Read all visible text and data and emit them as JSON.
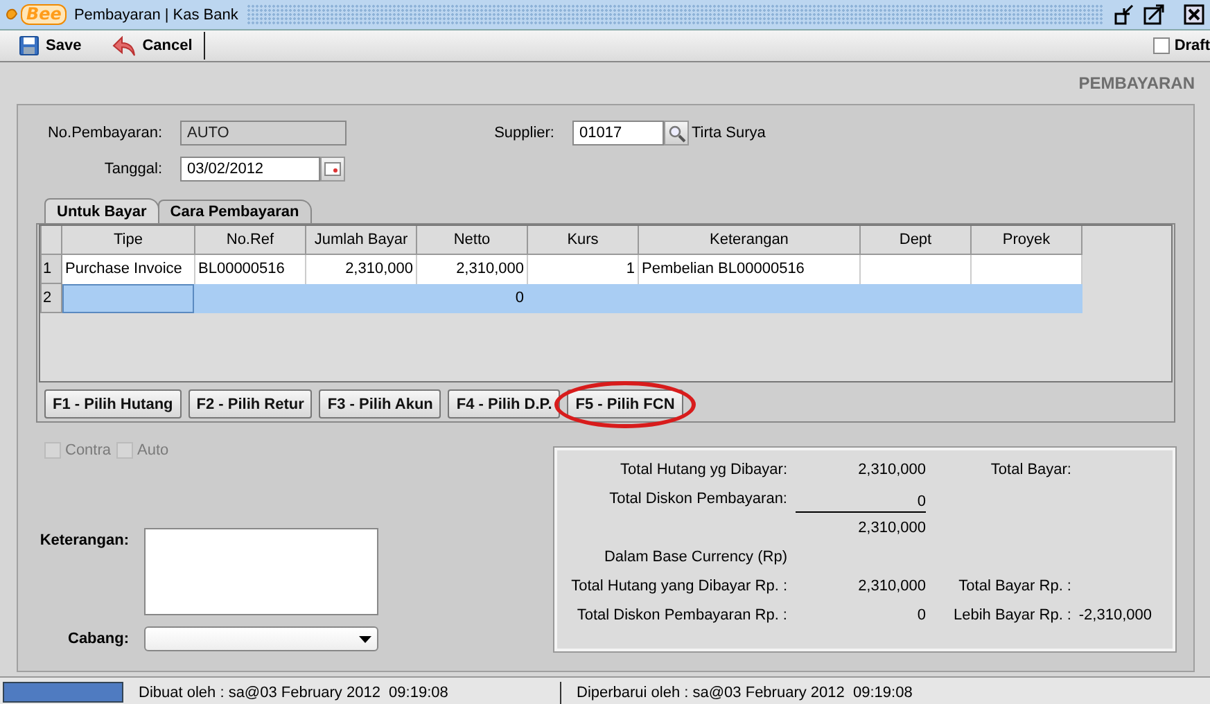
{
  "window": {
    "logo": "Bee",
    "title": "Pembayaran | Kas Bank"
  },
  "toolbar": {
    "buttons": [
      {
        "kind": "save",
        "label": "Save"
      },
      {
        "kind": "cancel",
        "label": "Cancel"
      }
    ],
    "draft": {
      "label": "Draft",
      "checked": false
    }
  },
  "heading": "PEMBAYARAN",
  "form": {
    "no_pembayaran": {
      "label": "No.Pembayaran:",
      "value": "AUTO",
      "disabled": true
    },
    "tanggal": {
      "label": "Tanggal:",
      "value": "03/02/2012"
    },
    "supplier": {
      "label": "Supplier:",
      "value": "01017",
      "name": "Tirta Surya"
    }
  },
  "tabs": [
    {
      "label": "Untuk Bayar",
      "selected": true
    },
    {
      "label": "Cara Pembayaran",
      "selected": false
    }
  ],
  "table": {
    "columns": [
      {
        "label": "Tipe",
        "kind": "text"
      },
      {
        "label": "No.Ref",
        "kind": "text"
      },
      {
        "label": "Jumlah Bayar",
        "kind": "number"
      },
      {
        "label": "Netto",
        "kind": "number"
      },
      {
        "label": "Kurs",
        "kind": "number"
      },
      {
        "label": "Keterangan",
        "kind": "wide"
      },
      {
        "label": "Dept",
        "kind": "text"
      },
      {
        "label": "Proyek",
        "kind": "text"
      }
    ],
    "rows": [
      {
        "number": "1",
        "selected": false,
        "cells": [
          "Purchase Invoice",
          "BL00000516",
          "2,310,000",
          "2,310,000",
          "1",
          "Pembelian BL00000516",
          "",
          ""
        ]
      },
      {
        "number": "2",
        "selected": true,
        "cells": [
          "",
          "",
          "",
          "0",
          "",
          "",
          "",
          ""
        ]
      }
    ]
  },
  "function_buttons": [
    {
      "label": "F1 - Pilih Hutang",
      "highlighted": false
    },
    {
      "label": "F2 - Pilih Retur",
      "highlighted": false
    },
    {
      "label": "F3 - Pilih Akun",
      "highlighted": false
    },
    {
      "label": "F4 - Pilih D.P.",
      "highlighted": false
    },
    {
      "label": "F5 - Pilih FCN",
      "highlighted": true
    }
  ],
  "options": [
    {
      "label": "Contra",
      "checked": false,
      "disabled": true
    },
    {
      "label": "Auto",
      "checked": false,
      "disabled": true
    }
  ],
  "keterangan": {
    "label": "Keterangan:"
  },
  "cabang": {
    "label": "Cabang:"
  },
  "totals": [
    {
      "label": "Total Hutang yg Dibayar:",
      "value": "2,310,000",
      "side_label": "Total Bayar:",
      "rule_below": false
    },
    {
      "label": "Total Diskon Pembayaran:",
      "value": "0",
      "rule_below": true
    },
    {
      "value": "2,310,000",
      "rule_below": false
    },
    {
      "label": "Dalam Base Currency (Rp)",
      "rule_below": false
    },
    {
      "label": "Total Hutang yang Dibayar Rp. :",
      "value": "2,310,000",
      "side_label": "Total Bayar Rp. :",
      "rule_below": false
    },
    {
      "label": "Total Diskon Pembayaran Rp. :",
      "value": "0",
      "side_label": "Lebih Bayar Rp. :",
      "side_value": "-2,310,000",
      "rule_below": false
    }
  ],
  "status_bar": {
    "created": "Dibuat oleh : sa@03 February 2012  09:19:08",
    "updated": "Diperbarui oleh : sa@03 February 2012  09:19:08"
  }
}
